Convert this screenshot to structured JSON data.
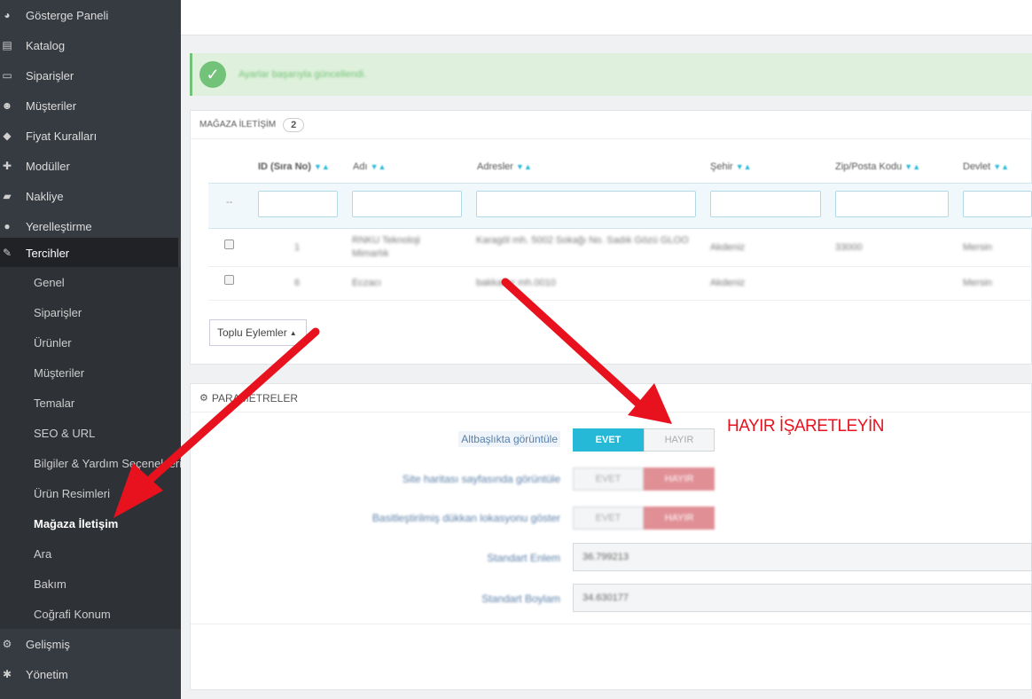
{
  "sidebar": {
    "items": [
      {
        "label": "Gösterge Paneli",
        "icon": "dashboard-icon",
        "glyph": "◕"
      },
      {
        "label": "Katalog",
        "icon": "book-icon",
        "glyph": "▤"
      },
      {
        "label": "Siparişler",
        "icon": "credit-card-icon",
        "glyph": "▭"
      },
      {
        "label": "Müşteriler",
        "icon": "users-icon",
        "glyph": "☻"
      },
      {
        "label": "Fiyat Kuralları",
        "icon": "tag-icon",
        "glyph": "◆"
      },
      {
        "label": "Modüller",
        "icon": "puzzle-icon",
        "glyph": "✚"
      },
      {
        "label": "Nakliye",
        "icon": "truck-icon",
        "glyph": "▰"
      },
      {
        "label": "Yerelleştirme",
        "icon": "globe-icon",
        "glyph": "●"
      },
      {
        "label": "Tercihler",
        "icon": "wrench-icon",
        "glyph": "✎"
      }
    ],
    "sub_items": [
      {
        "label": "Genel"
      },
      {
        "label": "Siparişler"
      },
      {
        "label": "Ürünler"
      },
      {
        "label": "Müşteriler"
      },
      {
        "label": "Temalar"
      },
      {
        "label": "SEO & URL"
      },
      {
        "label": "Bilgiler & Yardım Seçenekleri"
      },
      {
        "label": "Ürün Resimleri"
      },
      {
        "label": "Mağaza İletişim"
      },
      {
        "label": "Ara"
      },
      {
        "label": "Bakım"
      },
      {
        "label": "Coğrafi Konum"
      }
    ],
    "bottom_items": [
      {
        "label": "Gelişmiş",
        "icon": "cogs-icon",
        "glyph": "⚙"
      },
      {
        "label": "Yönetim",
        "icon": "gear-icon",
        "glyph": "✱"
      }
    ]
  },
  "alert": {
    "message": "Ayarlar başarıyla güncellendi."
  },
  "contacts_panel": {
    "title": "MAĞAZA İLETİŞİM",
    "count": "2",
    "columns": [
      "ID (Sıra No)",
      "Adı",
      "Adresler",
      "Şehir",
      "Zip/Posta Kodu",
      "Devlet"
    ],
    "filter_dash": "--",
    "rows": [
      {
        "id": "1",
        "name": "RNKU Teknoloji Mimarlık",
        "address": "Karagöl mh. 5002 Sokağı No. Sadık Gözü GLOO",
        "city": "Akdeniz",
        "zip": "33000",
        "state": "Mersin"
      },
      {
        "id": "6",
        "name": "Eczacı",
        "address": "bakkallar mh.0010",
        "city": "Akdeniz",
        "zip": "",
        "state": "Mersin"
      }
    ],
    "bulk_actions": "Toplu Eylemler"
  },
  "params_panel": {
    "title": "PARAMETRELER",
    "fields": [
      {
        "label": "Altbaşlıkta görüntüle",
        "yes": "EVET",
        "no": "HAYIR",
        "value": "yes"
      },
      {
        "label": "Site haritası sayfasında görüntüle",
        "yes": "EVET",
        "no": "HAYIR",
        "value": "no"
      },
      {
        "label": "Basitleştirilmiş dükkan lokasyonu göster",
        "yes": "EVET",
        "no": "HAYIR",
        "value": "no"
      }
    ],
    "latitude_label": "Standart Enlem",
    "latitude_value": "36.799213",
    "longitude_label": "Standart Boylam",
    "longitude_value": "34.630177"
  },
  "annotation": {
    "text": "HAYIR İŞARETLEYİN"
  },
  "colors": {
    "sidebar": "#363a41",
    "accent": "#25b9d7",
    "arrow": "#e8121e",
    "success": "#72c279"
  }
}
